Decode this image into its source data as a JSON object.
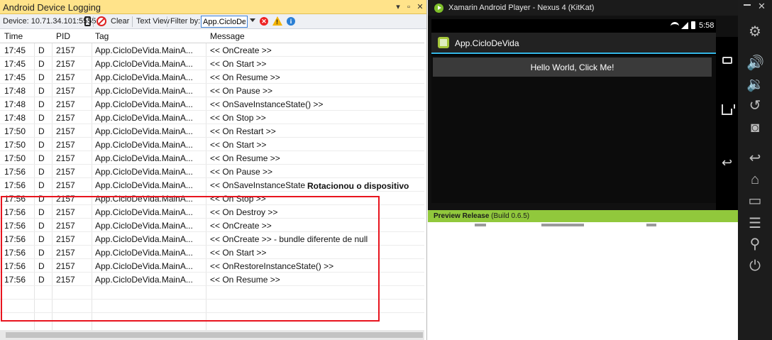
{
  "log_panel": {
    "title": "Android Device Logging",
    "title_buttons": {
      "dropdown": "▾",
      "pin": "▫",
      "close": "✕"
    },
    "toolbar": {
      "device_label": "Device: 10.71.34.101:5555",
      "clear_label": "Clear",
      "text_view_label": "Text View",
      "filter_label": "Filter by:",
      "filter_value": "App.CicloDeVi"
    },
    "columns": [
      "Time",
      "",
      "PID",
      "Tag",
      "Message"
    ],
    "rows": [
      {
        "time": "17:45",
        "level": "D",
        "pid": "2157",
        "tag": "App.CicloDeVida.MainActivity",
        "message": "<< OnCreate >>"
      },
      {
        "time": "17:45",
        "level": "D",
        "pid": "2157",
        "tag": "App.CicloDeVida.MainActivity",
        "message": "<< On Start >>"
      },
      {
        "time": "17:45",
        "level": "D",
        "pid": "2157",
        "tag": "App.CicloDeVida.MainActivity",
        "message": "<< On Resume >>"
      },
      {
        "time": "17:48",
        "level": "D",
        "pid": "2157",
        "tag": "App.CicloDeVida.MainActivity",
        "message": "<< On Pause >>"
      },
      {
        "time": "17:48",
        "level": "D",
        "pid": "2157",
        "tag": "App.CicloDeVida.MainActivity",
        "message": "<< OnSaveInstanceState() >>"
      },
      {
        "time": "17:48",
        "level": "D",
        "pid": "2157",
        "tag": "App.CicloDeVida.MainActivity",
        "message": "<< On Stop >>"
      },
      {
        "time": "17:50",
        "level": "D",
        "pid": "2157",
        "tag": "App.CicloDeVida.MainActivity",
        "message": "<< On Restart >>"
      },
      {
        "time": "17:50",
        "level": "D",
        "pid": "2157",
        "tag": "App.CicloDeVida.MainActivity",
        "message": "<< On Start >>"
      },
      {
        "time": "17:50",
        "level": "D",
        "pid": "2157",
        "tag": "App.CicloDeVida.MainActivity",
        "message": "<< On Resume >>"
      },
      {
        "time": "17:56",
        "level": "D",
        "pid": "2157",
        "tag": "App.CicloDeVida.MainActivity",
        "message": "<< On Pause >>"
      },
      {
        "time": "17:56",
        "level": "D",
        "pid": "2157",
        "tag": "App.CicloDeVida.MainActivity",
        "message": "<< OnSaveInstanceState() >>"
      },
      {
        "time": "17:56",
        "level": "D",
        "pid": "2157",
        "tag": "App.CicloDeVida.MainActivity",
        "message": "<< On Stop >>"
      },
      {
        "time": "17:56",
        "level": "D",
        "pid": "2157",
        "tag": "App.CicloDeVida.MainActivity",
        "message": "<< On Destroy >>"
      },
      {
        "time": "17:56",
        "level": "D",
        "pid": "2157",
        "tag": "App.CicloDeVida.MainActivity",
        "message": "<< OnCreate >>"
      },
      {
        "time": "17:56",
        "level": "D",
        "pid": "2157",
        "tag": "App.CicloDeVida.MainActivity",
        "message": "<< OnCreate >> - bundle diferente de null"
      },
      {
        "time": "17:56",
        "level": "D",
        "pid": "2157",
        "tag": "App.CicloDeVida.MainActivity",
        "message": "<< On Start >>"
      },
      {
        "time": "17:56",
        "level": "D",
        "pid": "2157",
        "tag": "App.CicloDeVida.MainActivity",
        "message": "<< OnRestoreInstanceState() >>"
      },
      {
        "time": "17:56",
        "level": "D",
        "pid": "2157",
        "tag": "App.CicloDeVida.MainActivity",
        "message": "<< On Resume >>"
      }
    ],
    "annotation": "Rotacionou o dispositivo",
    "highlight_color": "#e8141e"
  },
  "player": {
    "title": "Xamarin Android Player - Nexus 4 (KitKat)",
    "status_time": "5:58",
    "app_title": "App.CicloDeVida",
    "button_label": "Hello World, Click Me!",
    "status_bar_strong": "Preview Release",
    "status_bar_rest": " (Build 0.6.5)",
    "status_bar_color": "#91c83c",
    "nav_icons": [
      "recent-apps-icon",
      "home-icon",
      "back-icon"
    ]
  },
  "sidebar": {
    "icons": [
      "gear-icon",
      "volume-up-icon",
      "volume-down-icon",
      "rotate-icon",
      "camera-icon",
      "back-icon",
      "home-icon",
      "recent-apps-icon",
      "menu-icon",
      "search-icon",
      "power-icon"
    ]
  }
}
